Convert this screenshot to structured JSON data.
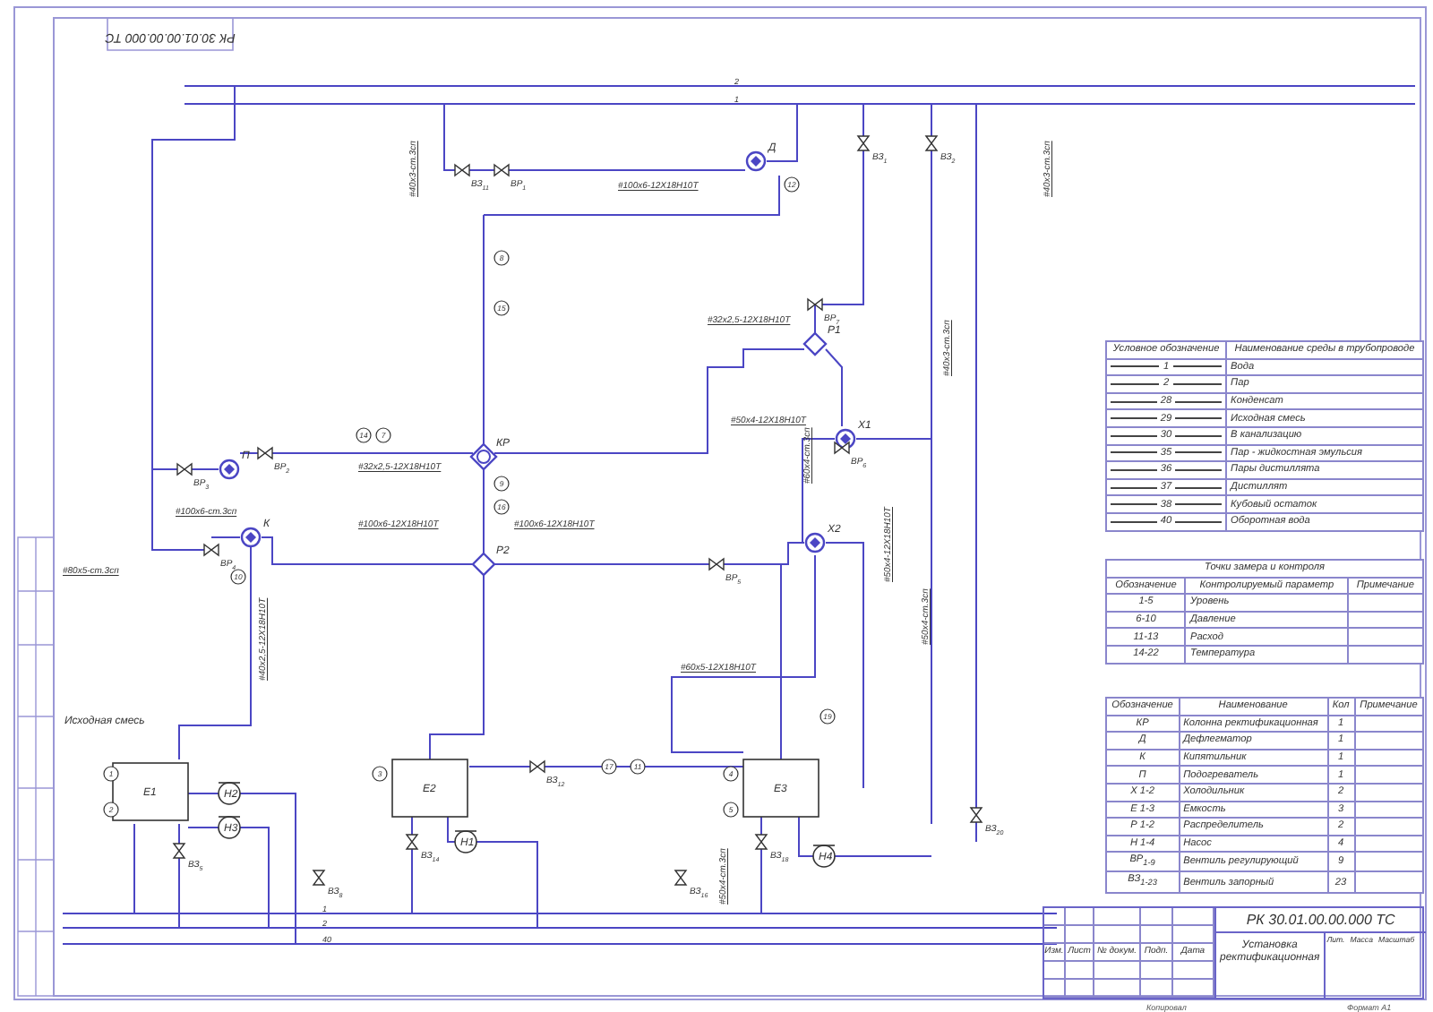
{
  "stamp": {
    "code": "РК 30.01.00.00.000 ТС"
  },
  "diagram": {
    "feed_label": "Исходная смесь",
    "line_codes": [
      "2",
      "1",
      "1",
      "2",
      "40"
    ],
    "equipment": [
      {
        "label": "КР",
        "kind": "column"
      },
      {
        "label": "Р2",
        "kind": "distributor"
      },
      {
        "label": "Р1",
        "kind": "distributor"
      },
      {
        "label": "Д",
        "kind": "exchanger"
      },
      {
        "label": "П",
        "kind": "exchanger"
      },
      {
        "label": "К",
        "kind": "exchanger"
      },
      {
        "label": "Х1",
        "kind": "exchanger"
      },
      {
        "label": "Х2",
        "kind": "exchanger"
      },
      {
        "label": "Е1",
        "kind": "tank"
      },
      {
        "label": "Е2",
        "kind": "tank"
      },
      {
        "label": "Е3",
        "kind": "tank"
      },
      {
        "label": "Н1",
        "kind": "pump"
      },
      {
        "label": "Н2",
        "kind": "pump"
      },
      {
        "label": "Н3",
        "kind": "pump"
      },
      {
        "label": "Н4",
        "kind": "pump"
      }
    ],
    "pipe_specs": [
      "#100x6-ст.3сп",
      "#32x2,5-12Х18Н10Т",
      "#100x6-12Х18Н10Т",
      "#100x6-12Х18Н10Т",
      "#80x5-ст.3сп",
      "#40x3-ст.3сп",
      "#100x6-12Х18Н10Т",
      "#32x2,5-12Х18Н10Т",
      "#50x4-12Х18Н10Т",
      "#40x3-ст.3сп",
      "#40x3-ст.3сп",
      "#50x4-12Х18Н10Т",
      "#50x4-ст.3сп",
      "#60x5-12Х18Н10Т",
      "#50x4-ст.3сп",
      "#40x2,5-12Х18Н10Т",
      "#60x4-ст.3сп"
    ],
    "valves": [
      {
        "name": "ВЗ",
        "sub": "11"
      },
      {
        "name": "ВР",
        "sub": "1"
      },
      {
        "name": "ВР",
        "sub": "3"
      },
      {
        "name": "ВР",
        "sub": "2"
      },
      {
        "name": "ВР",
        "sub": "4"
      },
      {
        "name": "ВР",
        "sub": "5"
      },
      {
        "name": "ВР",
        "sub": "6"
      },
      {
        "name": "ВР",
        "sub": "7"
      },
      {
        "name": "ВЗ",
        "sub": "1"
      },
      {
        "name": "ВЗ",
        "sub": "2"
      },
      {
        "name": "ВЗ",
        "sub": "5"
      },
      {
        "name": "ВЗ",
        "sub": "8"
      },
      {
        "name": "ВЗ",
        "sub": "12"
      },
      {
        "name": "ВЗ",
        "sub": "14"
      },
      {
        "name": "ВЗ",
        "sub": "16"
      },
      {
        "name": "ВЗ",
        "sub": "18"
      },
      {
        "name": "ВЗ",
        "sub": "20"
      }
    ],
    "instruments": [
      "14",
      "7",
      "8",
      "15",
      "9",
      "16",
      "10",
      "17",
      "11",
      "12",
      "19",
      "1",
      "2",
      "3",
      "4",
      "5"
    ]
  },
  "media_legend": {
    "columns": [
      "Условное обозначение",
      "Наименование среды в трубопроводе"
    ],
    "rows": [
      {
        "code": "1",
        "name": "Вода"
      },
      {
        "code": "2",
        "name": "Пар"
      },
      {
        "code": "28",
        "name": "Конденсат"
      },
      {
        "code": "29",
        "name": "Исходная смесь"
      },
      {
        "code": "30",
        "name": "В канализацию"
      },
      {
        "code": "35",
        "name": "Пар - жидкостная эмульсия"
      },
      {
        "code": "36",
        "name": "Пары дистиллята"
      },
      {
        "code": "37",
        "name": "Дистиллят"
      },
      {
        "code": "38",
        "name": "Кубовый остаток"
      },
      {
        "code": "40",
        "name": "Оборотная вода"
      }
    ]
  },
  "control_points": {
    "title": "Точки замера и контроля",
    "columns": [
      "Обозначение",
      "Контролируемый параметр",
      "Примечание"
    ],
    "rows": [
      {
        "range": "1-5",
        "parameter": "Уровень"
      },
      {
        "range": "6-10",
        "parameter": "Давление"
      },
      {
        "range": "11-13",
        "parameter": "Расход"
      },
      {
        "range": "14-22",
        "parameter": "Температура"
      }
    ]
  },
  "equipment_list": {
    "columns": [
      "Обозначение",
      "Наименование",
      "Кол",
      "Примечание"
    ],
    "rows": [
      {
        "designation": "КР",
        "name": "Колонна ректификационная",
        "qty": "1"
      },
      {
        "designation": "Д",
        "name": "Дефлегматор",
        "qty": "1"
      },
      {
        "designation": "К",
        "name": "Кипятильник",
        "qty": "1"
      },
      {
        "designation": "П",
        "name": "Подогреватель",
        "qty": "1"
      },
      {
        "designation": "Х 1-2",
        "name": "Холодильник",
        "qty": "2"
      },
      {
        "designation": "Е 1-3",
        "name": "Емкость",
        "qty": "3"
      },
      {
        "designation": "Р 1-2",
        "name": "Распределитель",
        "qty": "2"
      },
      {
        "designation": "Н 1-4",
        "name": "Насос",
        "qty": "4"
      },
      {
        "designation": "ВР$_{1-9}$",
        "name": "Вентиль регулирующий",
        "qty": "9"
      },
      {
        "designation": "ВЗ$_{1-23}$",
        "name": "Вентиль запорный",
        "qty": "23"
      }
    ]
  },
  "title_block": {
    "code": "РК 30.01.00.00.000 ТС",
    "name": "Установка ректификационная",
    "header_cells": [
      "Изм.",
      "Лист",
      "№ докум.",
      "Подп.",
      "Дата"
    ],
    "info_cells": [
      "Лит.",
      "Масса",
      "Масштаб"
    ],
    "copied": "Копировал",
    "format": "Формат А1"
  }
}
